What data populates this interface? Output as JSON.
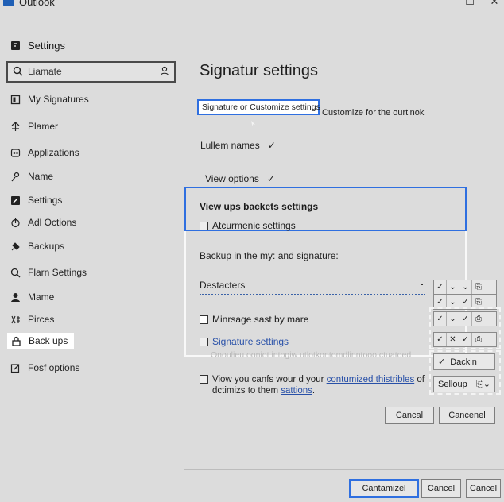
{
  "window": {
    "title": "Outlook",
    "dash": "–",
    "minimize": "—",
    "maximize": "☐",
    "close": "✕"
  },
  "sidebar": {
    "heading": "Settings",
    "search": {
      "value": "Liamate"
    },
    "items": [
      {
        "label": "My Signatures",
        "icon": "signature-icon"
      },
      {
        "label": "Plamer",
        "icon": "planner-icon"
      },
      {
        "label": "Applizations",
        "icon": "apps-icon"
      },
      {
        "label": "Name",
        "icon": "name-icon"
      },
      {
        "label": "Settings",
        "icon": "settings-icon"
      },
      {
        "label": "Adl Octions",
        "icon": "options-icon"
      },
      {
        "label": "Backups",
        "icon": "backups-icon"
      },
      {
        "label": "Flarn Settings",
        "icon": "flarn-icon"
      },
      {
        "label": "Mame",
        "icon": "person-icon"
      },
      {
        "label": "Pirces",
        "icon": "prices-icon"
      },
      {
        "label": "Back ups",
        "icon": "lock-icon",
        "active": true
      },
      {
        "label": "Fosf options",
        "icon": "edit-icon"
      }
    ]
  },
  "main": {
    "title": "Signatur settings",
    "signature_button": "Signature or Customize settings",
    "signature_desc": "Customize for the ourtlnok",
    "lullem_names": "Lullem names",
    "view_options": "View options",
    "checkmark": "✓",
    "section_title": "View ups backets settings",
    "atcurmenic": "Atcurmenic settings",
    "backup_line": "Backup in the my: and signature:",
    "destacters": "Destacters",
    "minrsage": "Minrsage sast by mare",
    "signature_settings": "Signature settings",
    "faint_text": "Onoulieu ooniot intogiw utlotkontomdlinntooo ctuatoed",
    "view_line1_pre": "Viow you canfs wour d your ",
    "view_line1_link": "contumized thistribles",
    "view_line1_post": " of",
    "view_line2_pre": "dctimizs to them ",
    "view_line2_link": "sattions",
    "view_line2_post": "."
  },
  "controls": {
    "dackin": "Dackin",
    "selloup": "Selloup"
  },
  "buttons": {
    "cancel1": "Cancal",
    "cancel2": "Cancenel",
    "cantamized": "Cantamizel",
    "cancel3": "Cancel",
    "cancel4": "Cancel"
  }
}
